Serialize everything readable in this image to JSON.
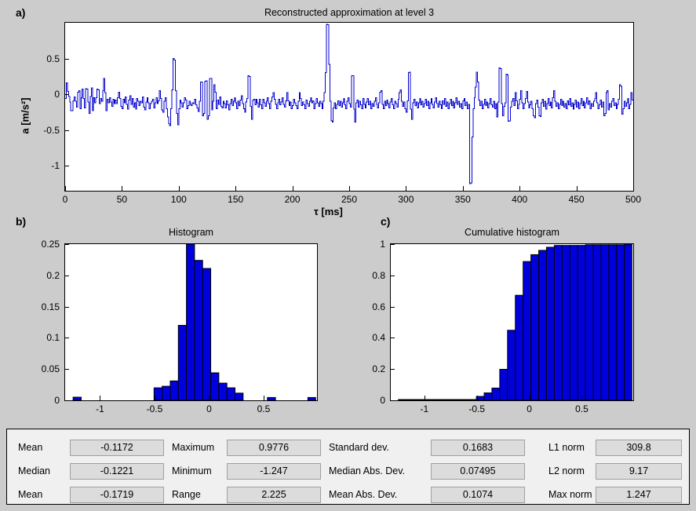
{
  "figure": {
    "background": "#cccccc",
    "panel_letters": [
      "a)",
      "b)",
      "c)"
    ]
  },
  "panel_a": {
    "letter": "a)",
    "title": "Reconstructed approximation at level 3",
    "ylabel": "a [m/s²]",
    "xlabel": "τ [ms]",
    "yticks": [
      "0.5",
      "0",
      "-0.5",
      "-1"
    ],
    "xticks": [
      "0",
      "50",
      "100",
      "150",
      "200",
      "250",
      "300",
      "350",
      "400",
      "450",
      "500"
    ]
  },
  "panel_b": {
    "letter": "b)",
    "title": "Histogram",
    "yticks": [
      "0.25",
      "0.2",
      "0.15",
      "0.1",
      "0.05",
      "0"
    ],
    "xticks": [
      "-1",
      "-0.5",
      "0",
      "0.5"
    ]
  },
  "panel_c": {
    "letter": "c)",
    "title": "Cumulative histogram",
    "yticks": [
      "1",
      "0.8",
      "0.6",
      "0.4",
      "0.2",
      "0"
    ],
    "xticks": [
      "-1",
      "-0.5",
      "0",
      "0.5"
    ]
  },
  "stats": {
    "rows": [
      [
        {
          "label": "Mean",
          "value": "-0.1172"
        },
        {
          "label": "Maximum",
          "value": "0.9776"
        },
        {
          "label": "Standard dev.",
          "value": "0.1683"
        },
        {
          "label": "L1 norm",
          "value": "309.8"
        }
      ],
      [
        {
          "label": "Median",
          "value": "-0.1221"
        },
        {
          "label": "Minimum",
          "value": "-1.247"
        },
        {
          "label": "Median Abs. Dev.",
          "value": "0.07495"
        },
        {
          "label": "L2 norm",
          "value": "9.17"
        }
      ],
      [
        {
          "label": "Mean",
          "value": "-0.1719"
        },
        {
          "label": "Range",
          "value": "2.225"
        },
        {
          "label": "Mean Abs. Dev.",
          "value": "0.1074"
        },
        {
          "label": "Max norm",
          "value": "1.247"
        }
      ]
    ]
  },
  "chart_data": [
    {
      "id": "signal",
      "type": "line",
      "title": "Reconstructed approximation at level 3",
      "xlabel": "τ [ms]",
      "ylabel": "a [m/s²]",
      "xlim": [
        0,
        500
      ],
      "ylim": [
        -1.35,
        1.0
      ],
      "grid": false,
      "line_color": "#0000cc",
      "step_plot": true,
      "x_step": 2.5,
      "y": [
        -0.06,
        0.16,
        0.04,
        -0.03,
        -0.11,
        -0.23,
        -0.23,
        -0.09,
        -0.04,
        -0.1,
        -0.18,
        0.03,
        0.05,
        -0.2,
        -0.05,
        0.07,
        -0.06,
        -0.19,
        0.08,
        0.07,
        -0.11,
        -0.27,
        -0.03,
        0.09,
        -0.23,
        -0.05,
        -0.12,
        -0.05,
        0.07,
        0.06,
        -0.13,
        -0.06,
        -0.1,
        0.05,
        0.22,
        0.02,
        -0.23,
        -0.07,
        -0.12,
        -0.05,
        -0.11,
        -0.17,
        -0.07,
        -0.13,
        -0.08,
        -0.13,
        -0.05,
        0.03,
        -0.06,
        -0.17,
        -0.2,
        -0.07,
        -0.12,
        -0.04,
        -0.14,
        -0.21,
        -0.08,
        -0.02,
        -0.14,
        -0.06,
        -0.18,
        -0.12,
        -0.21,
        -0.06,
        -0.1,
        -0.16,
        -0.1,
        -0.12,
        -0.04,
        -0.18,
        -0.22,
        -0.11,
        -0.05,
        -0.12,
        -0.2,
        -0.13,
        -0.1,
        -0.07,
        -0.19,
        -0.12,
        -0.05,
        -0.13,
        -0.09,
        0.05,
        -0.06,
        -0.22,
        -0.25,
        -0.1,
        -0.05,
        -0.2,
        -0.32,
        -0.41,
        -0.44,
        -0.2,
        0.06,
        0.5,
        0.48,
        0.05,
        -0.27,
        -0.43,
        -0.2,
        -0.08,
        -0.12,
        -0.18,
        -0.12,
        -0.05,
        -0.08,
        -0.2,
        -0.16,
        -0.1,
        -0.14,
        -0.16,
        -0.12,
        -0.13,
        -0.07,
        -0.15,
        -0.19,
        -0.24,
        -0.1,
        0.17,
        0.17,
        -0.3,
        -0.27,
        0.18,
        0.19,
        -0.35,
        -0.3,
        0.22,
        0.22,
        -0.22,
        -0.1,
        0.13,
        0.03,
        -0.2,
        -0.08,
        -0.14,
        -0.04,
        -0.17,
        -0.19,
        -0.1,
        -0.13,
        -0.19,
        -0.09,
        -0.15,
        -0.22,
        -0.13,
        -0.07,
        -0.16,
        -0.1,
        -0.05,
        -0.12,
        -0.2,
        -0.1,
        -0.16,
        -0.08,
        -0.02,
        -0.13,
        -0.2,
        -0.25,
        -0.11,
        -0.06,
        0.26,
        0.25,
        -0.17,
        -0.35,
        -0.08,
        -0.07,
        -0.15,
        -0.07,
        -0.12,
        -0.18,
        -0.07,
        -0.15,
        -0.2,
        -0.07,
        -0.12,
        -0.17,
        -0.1,
        -0.05,
        -0.13,
        -0.2,
        -0.1,
        -0.04,
        0.02,
        -0.07,
        -0.14,
        -0.2,
        -0.12,
        -0.07,
        -0.15,
        -0.11,
        -0.05,
        -0.14,
        -0.18,
        -0.09,
        0.02,
        -0.09,
        -0.16,
        -0.11,
        -0.2,
        -0.16,
        -0.07,
        -0.12,
        -0.16,
        -0.2,
        -0.1,
        0.02,
        -0.06,
        -0.16,
        -0.11,
        -0.15,
        -0.2,
        -0.08,
        -0.13,
        -0.17,
        -0.1,
        -0.05,
        -0.12,
        -0.09,
        -0.2,
        -0.13,
        -0.06,
        -0.12,
        -0.17,
        -0.1,
        -0.13,
        -0.2,
        -0.1,
        0.02,
        0.3,
        0.98,
        0.97,
        0.42,
        -0.1,
        -0.37,
        -0.39,
        -0.19,
        -0.12,
        -0.2,
        -0.14,
        -0.09,
        -0.16,
        -0.1,
        -0.18,
        -0.12,
        -0.06,
        -0.15,
        -0.2,
        -0.1,
        -0.05,
        -0.13,
        -0.18,
        0.26,
        0.26,
        -0.21,
        -0.39,
        -0.12,
        -0.08,
        -0.18,
        -0.1,
        -0.15,
        -0.2,
        -0.06,
        -0.14,
        -0.19,
        -0.11,
        -0.06,
        -0.15,
        -0.1,
        -0.2,
        -0.13,
        -0.17,
        -0.1,
        -0.05,
        -0.14,
        -0.19,
        -0.12,
        0.03,
        0.05,
        -0.14,
        -0.2,
        -0.1,
        -0.16,
        -0.08,
        -0.13,
        -0.19,
        -0.11,
        -0.06,
        -0.15,
        -0.2,
        -0.1,
        -0.13,
        -0.18,
        -0.07,
        0.02,
        0.06,
        -0.1,
        -0.17,
        -0.11,
        -0.2,
        -0.25,
        -0.09,
        0.3,
        0.31,
        -0.21,
        -0.35,
        -0.12,
        -0.07,
        -0.16,
        -0.11,
        -0.19,
        -0.12,
        -0.06,
        -0.15,
        -0.1,
        -0.18,
        -0.13,
        -0.07,
        -0.16,
        -0.1,
        -0.2,
        -0.12,
        -0.06,
        -0.14,
        -0.19,
        -0.11,
        -0.05,
        -0.13,
        -0.18,
        -0.1,
        -0.15,
        -0.2,
        -0.09,
        -0.14,
        -0.06,
        -0.17,
        -0.11,
        -0.2,
        -0.13,
        -0.07,
        -0.16,
        -0.1,
        -0.19,
        -0.12,
        -0.05,
        -0.14,
        -0.1,
        -0.18,
        -0.13,
        -0.2,
        -0.09,
        -0.06,
        -0.16,
        -0.11,
        -0.2,
        -0.14,
        -1.25,
        -1.24,
        -0.6,
        -0.2,
        -0.05,
        0.1,
        0.31,
        0.17,
        -0.08,
        -0.16,
        -0.1,
        -0.2,
        -0.14,
        -0.07,
        -0.16,
        -0.11,
        -0.19,
        -0.13,
        -0.06,
        -0.15,
        -0.18,
        -0.1,
        -0.2,
        -0.13,
        -0.32,
        -0.11,
        0.37,
        0.36,
        -0.13,
        -0.3,
        -0.17,
        -0.12,
        0.28,
        0.27,
        -0.38,
        -0.37,
        -0.18,
        -0.1,
        -0.06,
        -0.16,
        0.02,
        -0.09,
        -0.2,
        -0.14,
        -0.07,
        0.05,
        -0.12,
        -0.2,
        -0.13,
        -0.06,
        0.04,
        -0.11,
        -0.19,
        -0.15,
        -0.1,
        -0.2,
        -0.3,
        -0.33,
        -0.13,
        -0.08,
        -0.18,
        -0.3,
        -0.31,
        -0.12,
        -0.07,
        -0.17,
        -0.1,
        -0.21,
        -0.13,
        -0.06,
        -0.16,
        -0.11,
        -0.19,
        -0.05,
        0.05,
        -0.1,
        -0.17,
        -0.12,
        -0.2,
        -0.14,
        -0.07,
        -0.16,
        -0.1,
        -0.18,
        -0.13,
        -0.2,
        -0.09,
        -0.15,
        -0.06,
        -0.17,
        -0.12,
        -0.21,
        -0.14,
        -0.08,
        -0.18,
        -0.11,
        -0.2,
        -0.13,
        -0.06,
        -0.16,
        -0.1,
        -0.19,
        -0.12,
        -0.05,
        -0.14,
        -0.09,
        -0.2,
        -0.13,
        -0.17,
        -0.1,
        -0.06,
        0.02,
        -0.12,
        -0.2,
        -0.15,
        -0.08,
        -0.18,
        -0.11,
        -0.3,
        -0.27,
        0.02,
        0.05,
        -0.22,
        -0.13,
        -0.18,
        -0.1,
        -0.06,
        -0.16,
        -0.12,
        -0.2,
        -0.14,
        -0.07,
        0.13,
        0.11,
        -0.28,
        -0.2,
        -0.1,
        -0.17,
        -0.12,
        -0.06,
        -0.2,
        -0.14,
        0.02,
        -0.08
      ]
    },
    {
      "id": "histogram",
      "type": "bar",
      "title": "Histogram",
      "xlabel": "",
      "ylabel": "",
      "xlim": [
        -1.32,
        0.99
      ],
      "ylim": [
        0,
        0.25
      ],
      "grid": false,
      "bar_color": "#0000dd",
      "bar_edge_color": "#000000",
      "bin_edges": [
        -1.247,
        -1.1727,
        -1.0985,
        -1.0242,
        -0.95,
        -0.8757,
        -0.8015,
        -0.7272,
        -0.653,
        -0.5787,
        -0.5045,
        -0.4302,
        -0.356,
        -0.2817,
        -0.2075,
        -0.1332,
        -0.059,
        0.0153,
        0.0895,
        0.1638,
        0.238,
        0.3123,
        0.3865,
        0.4608,
        0.535,
        0.6093,
        0.6835,
        0.7578,
        0.832,
        0.9063,
        0.9776
      ],
      "values": [
        0.005,
        0,
        0,
        0,
        0,
        0,
        0,
        0,
        0,
        0,
        0.02,
        0.0225,
        0.031,
        0.12,
        0.25,
        0.224,
        0.211,
        0.044,
        0.0275,
        0.02,
        0.0115,
        0,
        0,
        0,
        0.0045,
        0,
        0,
        0,
        0,
        0.0045
      ]
    },
    {
      "id": "cumulative-histogram",
      "type": "bar",
      "title": "Cumulative histogram",
      "xlabel": "",
      "ylabel": "",
      "xlim": [
        -1.32,
        0.99
      ],
      "ylim": [
        0,
        1
      ],
      "grid": false,
      "bar_color": "#0000dd",
      "bar_edge_color": "#000000",
      "bin_edges": [
        -1.247,
        -1.1727,
        -1.0985,
        -1.0242,
        -0.95,
        -0.8757,
        -0.8015,
        -0.7272,
        -0.653,
        -0.5787,
        -0.5045,
        -0.4302,
        -0.356,
        -0.2817,
        -0.2075,
        -0.1332,
        -0.059,
        0.0153,
        0.0895,
        0.1638,
        0.238,
        0.3123,
        0.3865,
        0.4608,
        0.535,
        0.6093,
        0.6835,
        0.7578,
        0.832,
        0.9063,
        0.9776
      ],
      "values": [
        0.005,
        0.005,
        0.005,
        0.005,
        0.005,
        0.005,
        0.005,
        0.005,
        0.005,
        0.005,
        0.025,
        0.0475,
        0.0785,
        0.1985,
        0.4485,
        0.6725,
        0.8885,
        0.9325,
        0.96,
        0.98,
        0.9915,
        0.9915,
        0.9915,
        0.9915,
        0.996,
        0.996,
        0.996,
        0.996,
        0.996,
        1.0
      ]
    }
  ]
}
